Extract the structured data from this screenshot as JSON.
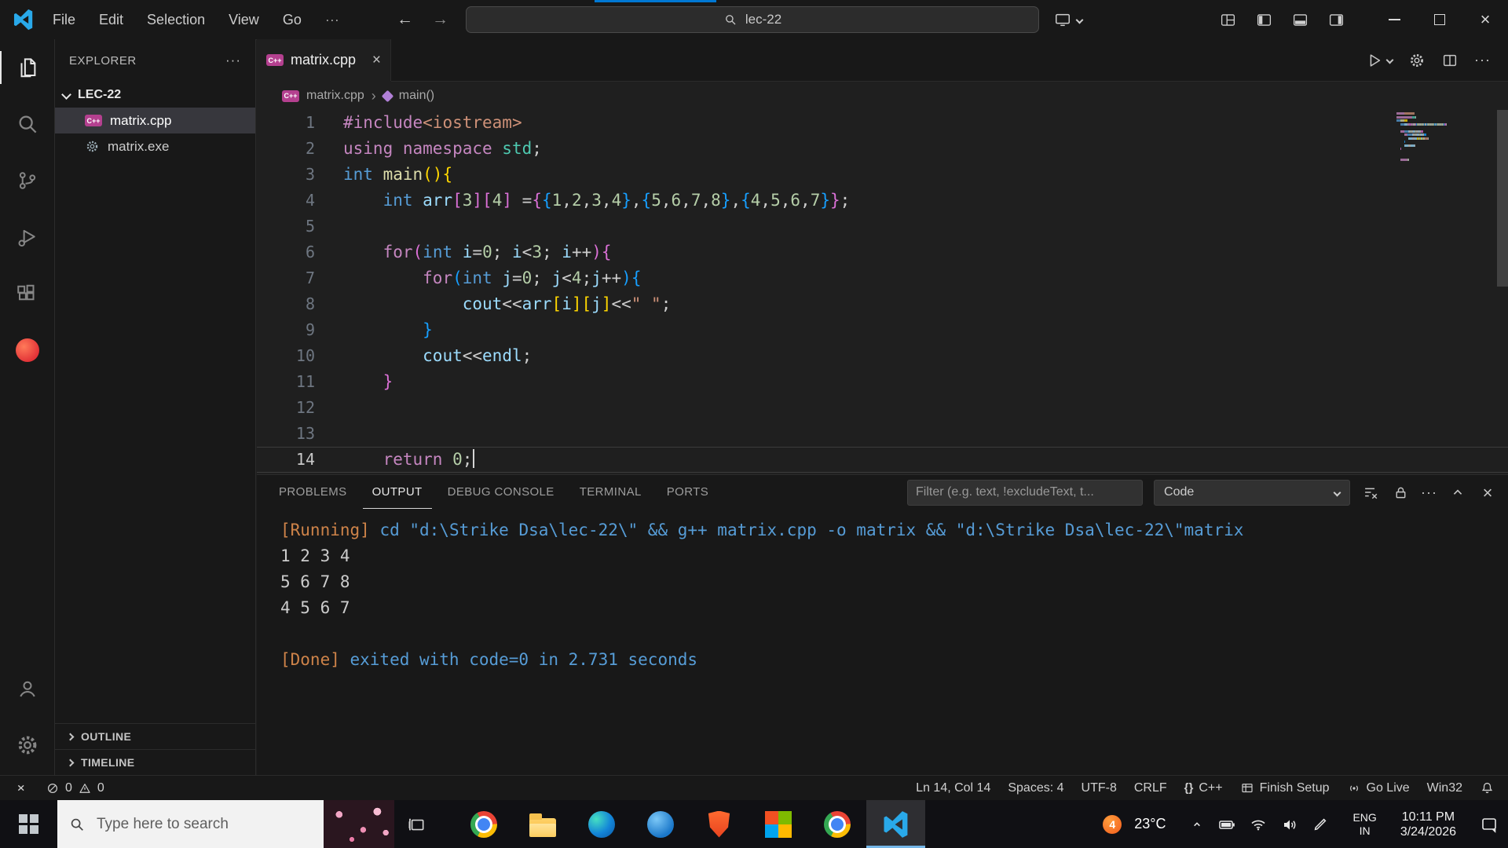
{
  "icons": {
    "close": "×",
    "minimize": "–",
    "back": "←",
    "forward": "→",
    "more": "···",
    "breadcrumb_sep": "›",
    "cpp": "C++"
  },
  "colors": {
    "accent_blue": "#0078d4",
    "activebar_highlight": "#e7e7e7"
  },
  "titlebar": {
    "menus": [
      "File",
      "Edit",
      "Selection",
      "View",
      "Go"
    ],
    "more_menu": "···",
    "search_value": "lec-22"
  },
  "sidebar": {
    "title": "EXPLORER",
    "root_folder": "LEC-22",
    "files": [
      {
        "name": "matrix.cpp",
        "icon": "cpp",
        "selected": true
      },
      {
        "name": "matrix.exe",
        "icon": "gear",
        "selected": false
      }
    ],
    "sections": [
      "OUTLINE",
      "TIMELINE"
    ]
  },
  "editor": {
    "tab": {
      "label": "matrix.cpp"
    },
    "breadcrumbs": [
      {
        "label": "matrix.cpp"
      },
      {
        "label": "main()"
      }
    ],
    "cursor": {
      "line": 14,
      "col": 14
    },
    "syntax_colors": {
      "ctrl": "#C586C0",
      "type": "#569CD6",
      "fn": "#DCDCAA",
      "var": "#9CDCFE",
      "num": "#B5CEA8",
      "str": "#CE9178",
      "plain": "#CCCCCC",
      "cls": "#4EC9B0",
      "b1": "#FFD700",
      "b2": "#DA70D6",
      "b3": "#179FFF",
      "tag": "#CE8349",
      "cmd": "#569CD6",
      "out": "#CCCCCC"
    },
    "lines": [
      {
        "tokens": [
          [
            "ctrl",
            "#include"
          ],
          [
            "str",
            "<iostream>"
          ]
        ]
      },
      {
        "tokens": [
          [
            "ctrl",
            "using "
          ],
          [
            "ctrl",
            "namespace "
          ],
          [
            "cls",
            "std"
          ],
          [
            "plain",
            ";"
          ]
        ]
      },
      {
        "tokens": [
          [
            "type",
            "int "
          ],
          [
            "fn",
            "main"
          ],
          [
            "b1",
            "(){"
          ]
        ]
      },
      {
        "tokens": [
          [
            "plain",
            "    "
          ],
          [
            "type",
            "int "
          ],
          [
            "var",
            "arr"
          ],
          [
            "b2",
            "["
          ],
          [
            "num",
            "3"
          ],
          [
            "b2",
            "]["
          ],
          [
            "num",
            "4"
          ],
          [
            "b2",
            "]"
          ],
          [
            "plain",
            " ="
          ],
          [
            "b2",
            "{"
          ],
          [
            "b3",
            "{"
          ],
          [
            "num",
            "1"
          ],
          [
            "plain",
            ","
          ],
          [
            "num",
            "2"
          ],
          [
            "plain",
            ","
          ],
          [
            "num",
            "3"
          ],
          [
            "plain",
            ","
          ],
          [
            "num",
            "4"
          ],
          [
            "b3",
            "}"
          ],
          [
            "plain",
            ","
          ],
          [
            "b3",
            "{"
          ],
          [
            "num",
            "5"
          ],
          [
            "plain",
            ","
          ],
          [
            "num",
            "6"
          ],
          [
            "plain",
            ","
          ],
          [
            "num",
            "7"
          ],
          [
            "plain",
            ","
          ],
          [
            "num",
            "8"
          ],
          [
            "b3",
            "}"
          ],
          [
            "plain",
            ","
          ],
          [
            "b3",
            "{"
          ],
          [
            "num",
            "4"
          ],
          [
            "plain",
            ","
          ],
          [
            "num",
            "5"
          ],
          [
            "plain",
            ","
          ],
          [
            "num",
            "6"
          ],
          [
            "plain",
            ","
          ],
          [
            "num",
            "7"
          ],
          [
            "b3",
            "}"
          ],
          [
            "b2",
            "}"
          ],
          [
            "plain",
            ";"
          ]
        ]
      },
      {
        "tokens": []
      },
      {
        "tokens": [
          [
            "plain",
            "    "
          ],
          [
            "ctrl",
            "for"
          ],
          [
            "b2",
            "("
          ],
          [
            "type",
            "int "
          ],
          [
            "var",
            "i"
          ],
          [
            "plain",
            "="
          ],
          [
            "num",
            "0"
          ],
          [
            "plain",
            "; "
          ],
          [
            "var",
            "i"
          ],
          [
            "plain",
            "<"
          ],
          [
            "num",
            "3"
          ],
          [
            "plain",
            "; "
          ],
          [
            "var",
            "i"
          ],
          [
            "plain",
            "++"
          ],
          [
            "b2",
            "){"
          ]
        ]
      },
      {
        "tokens": [
          [
            "plain",
            "        "
          ],
          [
            "ctrl",
            "for"
          ],
          [
            "b3",
            "("
          ],
          [
            "type",
            "int "
          ],
          [
            "var",
            "j"
          ],
          [
            "plain",
            "="
          ],
          [
            "num",
            "0"
          ],
          [
            "plain",
            "; "
          ],
          [
            "var",
            "j"
          ],
          [
            "plain",
            "<"
          ],
          [
            "num",
            "4"
          ],
          [
            "plain",
            ";"
          ],
          [
            "var",
            "j"
          ],
          [
            "plain",
            "++"
          ],
          [
            "b3",
            "){"
          ]
        ]
      },
      {
        "tokens": [
          [
            "plain",
            "            "
          ],
          [
            "var",
            "cout"
          ],
          [
            "plain",
            "<<"
          ],
          [
            "var",
            "arr"
          ],
          [
            "b1",
            "["
          ],
          [
            "var",
            "i"
          ],
          [
            "b1",
            "]["
          ],
          [
            "var",
            "j"
          ],
          [
            "b1",
            "]"
          ],
          [
            "plain",
            "<<"
          ],
          [
            "str",
            "\" \""
          ],
          [
            "plain",
            ";"
          ]
        ]
      },
      {
        "tokens": [
          [
            "plain",
            "        "
          ],
          [
            "b3",
            "}"
          ]
        ]
      },
      {
        "tokens": [
          [
            "plain",
            "        "
          ],
          [
            "var",
            "cout"
          ],
          [
            "plain",
            "<<"
          ],
          [
            "var",
            "endl"
          ],
          [
            "plain",
            ";"
          ]
        ]
      },
      {
        "tokens": [
          [
            "plain",
            "    "
          ],
          [
            "b2",
            "}"
          ]
        ]
      },
      {
        "tokens": []
      },
      {
        "tokens": []
      },
      {
        "tokens": [
          [
            "plain",
            "    "
          ],
          [
            "ctrl",
            "return "
          ],
          [
            "num",
            "0"
          ],
          [
            "plain",
            ";"
          ]
        ]
      }
    ]
  },
  "panel": {
    "tabs": [
      {
        "label": "PROBLEMS",
        "active": false
      },
      {
        "label": "OUTPUT",
        "active": true
      },
      {
        "label": "DEBUG CONSOLE",
        "active": false
      },
      {
        "label": "TERMINAL",
        "active": false
      },
      {
        "label": "PORTS",
        "active": false
      }
    ],
    "filter_placeholder": "Filter (e.g. text, !excludeText, t...",
    "channel": "Code",
    "output": [
      {
        "tokens": [
          [
            "tag",
            "[Running]"
          ],
          [
            "cmd",
            " cd \"d:\\Strike Dsa\\lec-22\\\" && g++ matrix.cpp -o matrix && \"d:\\Strike Dsa\\lec-22\\\"matrix"
          ]
        ]
      },
      {
        "tokens": [
          [
            "out",
            "1 2 3 4 "
          ]
        ]
      },
      {
        "tokens": [
          [
            "out",
            "5 6 7 8 "
          ]
        ]
      },
      {
        "tokens": [
          [
            "out",
            "4 5 6 7 "
          ]
        ]
      },
      {
        "tokens": []
      },
      {
        "tokens": [
          [
            "tag",
            "[Done]"
          ],
          [
            "cmd",
            " exited with code=0 in 2.731 seconds"
          ]
        ]
      }
    ]
  },
  "status_bar": {
    "errors": "0",
    "warnings": "0",
    "ln_col": "Ln 14, Col 14",
    "spaces": "Spaces: 4",
    "encoding": "UTF-8",
    "eol": "CRLF",
    "language": "C++",
    "finish_setup": "Finish Setup",
    "go_live": "Go Live",
    "platform": "Win32"
  },
  "taskbar": {
    "search_placeholder": "Type here to search",
    "apps": [
      {
        "kind": "chrome",
        "name": "browser-1",
        "active": false
      },
      {
        "kind": "folder",
        "name": "file-explorer",
        "active": false
      },
      {
        "kind": "edge",
        "name": "edge",
        "active": false
      },
      {
        "kind": "blueapp",
        "name": "blue-app",
        "active": false
      },
      {
        "kind": "brave",
        "name": "brave",
        "active": false
      },
      {
        "kind": "office",
        "name": "ms-office",
        "active": false
      },
      {
        "kind": "chrome",
        "name": "chrome",
        "active": false
      },
      {
        "kind": "vscode",
        "name": "vscode",
        "active": true
      }
    ],
    "tray": {
      "badge": "4",
      "temp": "23°C",
      "lang": "ENG",
      "region": "IN",
      "time": "10:11 PM",
      "date": "3/24/2026"
    }
  }
}
